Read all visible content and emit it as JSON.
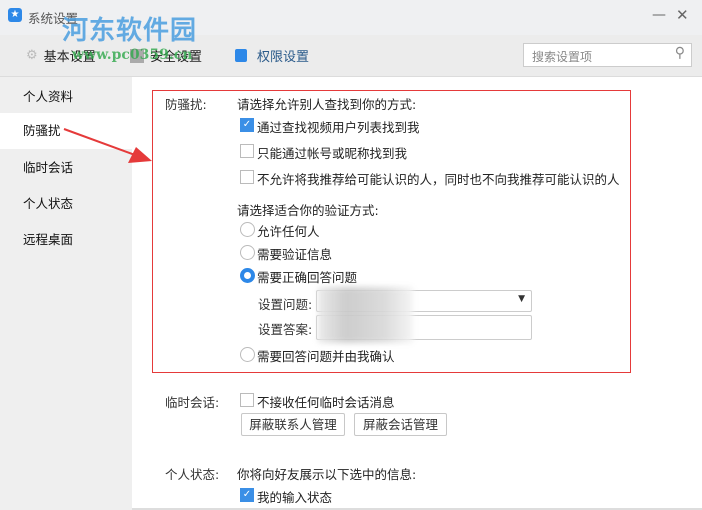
{
  "window": {
    "title": "系统设置",
    "minimize": "—",
    "close": "✕"
  },
  "watermark": {
    "name": "河东软件园",
    "url": "www.pc0359.cn"
  },
  "tabs": [
    {
      "label": "基本设置"
    },
    {
      "label": "安全设置"
    },
    {
      "label": "权限设置"
    }
  ],
  "search": {
    "placeholder": "搜索设置项"
  },
  "sidebar": {
    "items": [
      {
        "label": "个人资料"
      },
      {
        "label": "防骚扰"
      },
      {
        "label": "临时会话"
      },
      {
        "label": "个人状态"
      },
      {
        "label": "远程桌面"
      }
    ]
  },
  "anti": {
    "label": "防骚扰:",
    "find_heading": "请选择允许别人查找到你的方式:",
    "find_options": [
      {
        "label": "通过查找视频用户列表找到我",
        "checked": true
      },
      {
        "label": "只能通过帐号或昵称找到我",
        "checked": false
      },
      {
        "label": "不允许将我推荐给可能认识的人，同时也不向我推荐可能认识的人",
        "checked": false
      }
    ],
    "verify_heading": "请选择适合你的验证方式:",
    "verify_options": [
      {
        "label": "允许任何人"
      },
      {
        "label": "需要验证信息"
      },
      {
        "label": "需要正确回答问题",
        "selected": true
      },
      {
        "label": "需要回答问题并由我确认"
      }
    ],
    "question_label": "设置问题:",
    "answer_label": "设置答案:"
  },
  "temp": {
    "label": "临时会话:",
    "option": "不接收任何临时会话消息",
    "btn_contacts": "屏蔽联系人管理",
    "btn_sessions": "屏蔽会话管理"
  },
  "status": {
    "label": "个人状态:",
    "heading": "你将向好友展示以下选中的信息:",
    "option": "我的输入状态"
  },
  "colors": {
    "accent": "#2d88e8",
    "annotation": "#e53a3a"
  }
}
